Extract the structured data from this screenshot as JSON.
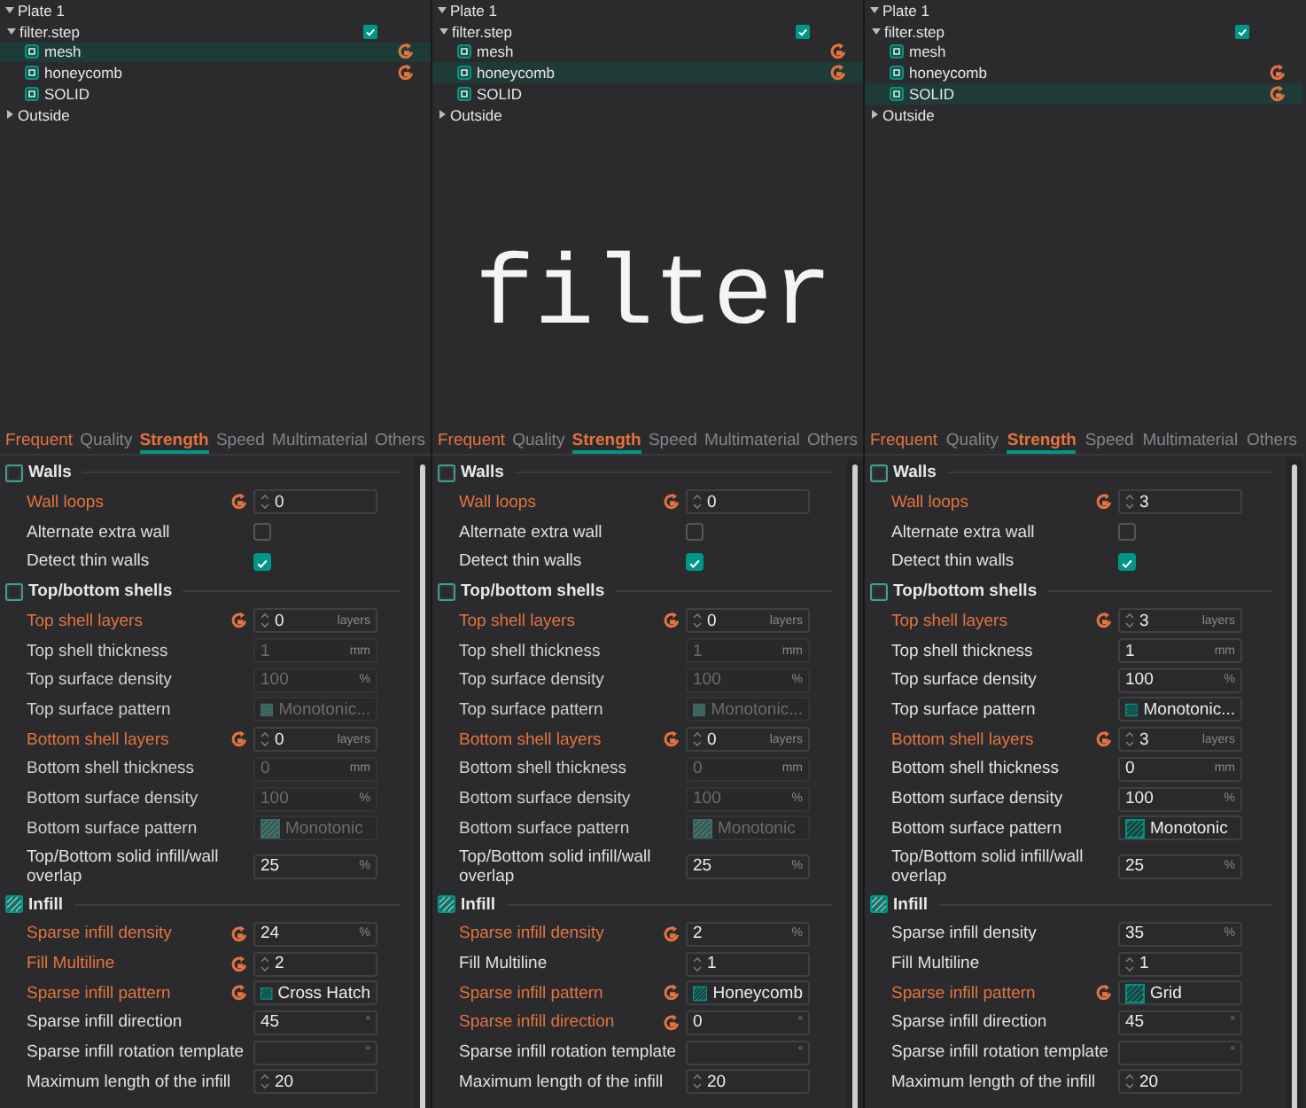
{
  "caption": "filter",
  "panels": [
    {
      "tree": [
        {
          "label": "Plate 1",
          "expanded": true,
          "selected": false,
          "children": [
            {
              "label": "filter.step",
              "expanded": true,
              "selected": false,
              "checked": true,
              "children": [
                {
                  "label": "mesh",
                  "selected": true,
                  "modified": true
                },
                {
                  "label": "honeycomb",
                  "selected": false,
                  "modified": true
                },
                {
                  "label": "SOLID",
                  "selected": false,
                  "modified": false
                }
              ]
            }
          ]
        },
        {
          "label": "Outside",
          "expanded": false,
          "selected": false
        }
      ],
      "tabs": [
        {
          "label": "Frequent",
          "selected": false,
          "modified": true
        },
        {
          "label": "Quality",
          "selected": false,
          "modified": false
        },
        {
          "label": "Strength",
          "selected": true,
          "modified": true
        },
        {
          "label": "Speed",
          "selected": false,
          "modified": false
        },
        {
          "label": "Multimaterial",
          "selected": false,
          "modified": false
        },
        {
          "label": "Others",
          "selected": false,
          "modified": false
        }
      ],
      "sections": [
        {
          "title": "Walls",
          "rows": [
            {
              "label": "Wall loops",
              "kind": "spin",
              "value": "0",
              "modified": true,
              "disabled": false
            },
            {
              "label": "Alternate extra wall",
              "kind": "check",
              "checked": false,
              "modified": false,
              "disabled": false
            },
            {
              "label": "Detect thin walls",
              "kind": "check",
              "checked": true,
              "modified": false,
              "disabled": false
            }
          ]
        },
        {
          "title": "Top/bottom shells",
          "rows": [
            {
              "label": "Top shell layers",
              "kind": "spin",
              "value": "0",
              "unit": "layers",
              "modified": true,
              "disabled": false
            },
            {
              "label": "Top shell thickness",
              "kind": "number",
              "value": "1",
              "unit": "mm",
              "modified": false,
              "disabled": true
            },
            {
              "label": "Top surface density",
              "kind": "number",
              "value": "100",
              "unit": "%",
              "modified": false,
              "disabled": true
            },
            {
              "label": "Top surface pattern",
              "kind": "pattern",
              "value": "Monotonic...",
              "modified": false,
              "disabled": true
            },
            {
              "label": "Bottom shell layers",
              "kind": "spin",
              "value": "0",
              "unit": "layers",
              "modified": true,
              "disabled": false
            },
            {
              "label": "Bottom shell thickness",
              "kind": "number",
              "value": "0",
              "unit": "mm",
              "modified": false,
              "disabled": true
            },
            {
              "label": "Bottom surface density",
              "kind": "number",
              "value": "100",
              "unit": "%",
              "modified": false,
              "disabled": true
            },
            {
              "label": "Bottom surface pattern",
              "kind": "pattern",
              "value": "Monotonic",
              "modified": false,
              "disabled": true
            },
            {
              "label": "Top/Bottom solid infill/wall overlap",
              "kind": "number",
              "value": "25",
              "unit": "%",
              "modified": false,
              "disabled": false
            }
          ]
        },
        {
          "title": "Infill",
          "rows": [
            {
              "label": "Sparse infill density",
              "kind": "number",
              "value": "24",
              "unit": "%",
              "modified": true,
              "disabled": false
            },
            {
              "label": "Fill Multiline",
              "kind": "spin",
              "value": "2",
              "modified": true,
              "disabled": false
            },
            {
              "label": "Sparse infill pattern",
              "kind": "pattern",
              "value": "Cross Hatch",
              "modified": true,
              "disabled": false
            },
            {
              "label": "Sparse infill direction",
              "kind": "number",
              "value": "45",
              "unit": "°",
              "modified": false,
              "disabled": false
            },
            {
              "label": "Sparse infill rotation template",
              "kind": "number",
              "unit": "°",
              "modified": false,
              "disabled": false
            },
            {
              "label": "Maximum length of the infill",
              "kind": "spin",
              "value": "20",
              "modified": false,
              "disabled": false
            }
          ]
        }
      ]
    },
    {
      "tree": [
        {
          "label": "Plate 1",
          "expanded": true,
          "selected": false,
          "children": [
            {
              "label": "filter.step",
              "expanded": true,
              "selected": false,
              "checked": true,
              "children": [
                {
                  "label": "mesh",
                  "selected": false,
                  "modified": true
                },
                {
                  "label": "honeycomb",
                  "selected": true,
                  "modified": true
                },
                {
                  "label": "SOLID",
                  "selected": false,
                  "modified": false
                }
              ]
            }
          ]
        },
        {
          "label": "Outside",
          "expanded": false,
          "selected": false
        }
      ],
      "tabs": [
        {
          "label": "Frequent",
          "selected": false,
          "modified": true
        },
        {
          "label": "Quality",
          "selected": false,
          "modified": false
        },
        {
          "label": "Strength",
          "selected": true,
          "modified": true
        },
        {
          "label": "Speed",
          "selected": false,
          "modified": false
        },
        {
          "label": "Multimaterial",
          "selected": false,
          "modified": false
        },
        {
          "label": "Others",
          "selected": false,
          "modified": false
        }
      ],
      "sections": [
        {
          "title": "Walls",
          "rows": [
            {
              "label": "Wall loops",
              "kind": "spin",
              "value": "0",
              "modified": true,
              "disabled": false
            },
            {
              "label": "Alternate extra wall",
              "kind": "check",
              "checked": false,
              "modified": false,
              "disabled": false
            },
            {
              "label": "Detect thin walls",
              "kind": "check",
              "checked": true,
              "modified": false,
              "disabled": false
            }
          ]
        },
        {
          "title": "Top/bottom shells",
          "rows": [
            {
              "label": "Top shell layers",
              "kind": "spin",
              "value": "0",
              "unit": "layers",
              "modified": true,
              "disabled": false
            },
            {
              "label": "Top shell thickness",
              "kind": "number",
              "value": "1",
              "unit": "mm",
              "modified": false,
              "disabled": true
            },
            {
              "label": "Top surface density",
              "kind": "number",
              "value": "100",
              "unit": "%",
              "modified": false,
              "disabled": true
            },
            {
              "label": "Top surface pattern",
              "kind": "pattern",
              "value": "Monotonic...",
              "modified": false,
              "disabled": true
            },
            {
              "label": "Bottom shell layers",
              "kind": "spin",
              "value": "0",
              "unit": "layers",
              "modified": true,
              "disabled": false
            },
            {
              "label": "Bottom shell thickness",
              "kind": "number",
              "value": "0",
              "unit": "mm",
              "modified": false,
              "disabled": true
            },
            {
              "label": "Bottom surface density",
              "kind": "number",
              "value": "100",
              "unit": "%",
              "modified": false,
              "disabled": true
            },
            {
              "label": "Bottom surface pattern",
              "kind": "pattern",
              "value": "Monotonic",
              "modified": false,
              "disabled": true
            },
            {
              "label": "Top/Bottom solid infill/wall overlap",
              "kind": "number",
              "value": "25",
              "unit": "%",
              "modified": false,
              "disabled": false
            }
          ]
        },
        {
          "title": "Infill",
          "rows": [
            {
              "label": "Sparse infill density",
              "kind": "number",
              "value": "2",
              "unit": "%",
              "modified": true,
              "disabled": false
            },
            {
              "label": "Fill Multiline",
              "kind": "spin",
              "value": "1",
              "modified": false,
              "disabled": false
            },
            {
              "label": "Sparse infill pattern",
              "kind": "pattern",
              "value": "Honeycomb",
              "modified": true,
              "disabled": false
            },
            {
              "label": "Sparse infill direction",
              "kind": "number",
              "value": "0",
              "unit": "°",
              "modified": true,
              "disabled": false
            },
            {
              "label": "Sparse infill rotation template",
              "kind": "number",
              "unit": "°",
              "modified": false,
              "disabled": false
            },
            {
              "label": "Maximum length of the infill",
              "kind": "spin",
              "value": "20",
              "modified": false,
              "disabled": false
            }
          ]
        }
      ]
    },
    {
      "tree": [
        {
          "label": "Plate 1",
          "expanded": true,
          "selected": false,
          "children": [
            {
              "label": "filter.step",
              "expanded": true,
              "selected": false,
              "checked": true,
              "children": [
                {
                  "label": "mesh",
                  "selected": false,
                  "modified": false
                },
                {
                  "label": "honeycomb",
                  "selected": false,
                  "modified": true
                },
                {
                  "label": "SOLID",
                  "selected": true,
                  "modified": true
                }
              ]
            }
          ]
        },
        {
          "label": "Outside",
          "expanded": false,
          "selected": false
        }
      ],
      "tabs": [
        {
          "label": "Frequent",
          "selected": false,
          "modified": true
        },
        {
          "label": "Quality",
          "selected": false,
          "modified": false
        },
        {
          "label": "Strength",
          "selected": true,
          "modified": true
        },
        {
          "label": "Speed",
          "selected": false,
          "modified": false
        },
        {
          "label": "Multimaterial",
          "selected": false,
          "modified": false
        },
        {
          "label": "Others",
          "selected": false,
          "modified": false
        }
      ],
      "sections": [
        {
          "title": "Walls",
          "rows": [
            {
              "label": "Wall loops",
              "kind": "spin",
              "value": "3",
              "modified": true,
              "disabled": false
            },
            {
              "label": "Alternate extra wall",
              "kind": "check",
              "checked": false,
              "modified": false,
              "disabled": false
            },
            {
              "label": "Detect thin walls",
              "kind": "check",
              "checked": true,
              "modified": false,
              "disabled": false
            }
          ]
        },
        {
          "title": "Top/bottom shells",
          "rows": [
            {
              "label": "Top shell layers",
              "kind": "spin",
              "value": "3",
              "unit": "layers",
              "modified": true,
              "disabled": false
            },
            {
              "label": "Top shell thickness",
              "kind": "number",
              "value": "1",
              "unit": "mm",
              "modified": false,
              "disabled": false
            },
            {
              "label": "Top surface density",
              "kind": "number",
              "value": "100",
              "unit": "%",
              "modified": false,
              "disabled": false
            },
            {
              "label": "Top surface pattern",
              "kind": "pattern",
              "value": "Monotonic...",
              "modified": false,
              "disabled": false
            },
            {
              "label": "Bottom shell layers",
              "kind": "spin",
              "value": "3",
              "unit": "layers",
              "modified": true,
              "disabled": false
            },
            {
              "label": "Bottom shell thickness",
              "kind": "number",
              "value": "0",
              "unit": "mm",
              "modified": false,
              "disabled": false
            },
            {
              "label": "Bottom surface density",
              "kind": "number",
              "value": "100",
              "unit": "%",
              "modified": false,
              "disabled": false
            },
            {
              "label": "Bottom surface pattern",
              "kind": "pattern",
              "value": "Monotonic",
              "modified": false,
              "disabled": false
            },
            {
              "label": "Top/Bottom solid infill/wall overlap",
              "kind": "number",
              "value": "25",
              "unit": "%",
              "modified": false,
              "disabled": false
            }
          ]
        },
        {
          "title": "Infill",
          "rows": [
            {
              "label": "Sparse infill density",
              "kind": "number",
              "value": "35",
              "unit": "%",
              "modified": false,
              "disabled": false
            },
            {
              "label": "Fill Multiline",
              "kind": "spin",
              "value": "1",
              "modified": false,
              "disabled": false
            },
            {
              "label": "Sparse infill pattern",
              "kind": "pattern",
              "value": "Grid",
              "modified": true,
              "disabled": false
            },
            {
              "label": "Sparse infill direction",
              "kind": "number",
              "value": "45",
              "unit": "°",
              "modified": false,
              "disabled": false
            },
            {
              "label": "Sparse infill rotation template",
              "kind": "number",
              "unit": "°",
              "modified": false,
              "disabled": false
            },
            {
              "label": "Maximum length of the infill",
              "kind": "spin",
              "value": "20",
              "modified": false,
              "disabled": false
            }
          ]
        }
      ]
    }
  ]
}
